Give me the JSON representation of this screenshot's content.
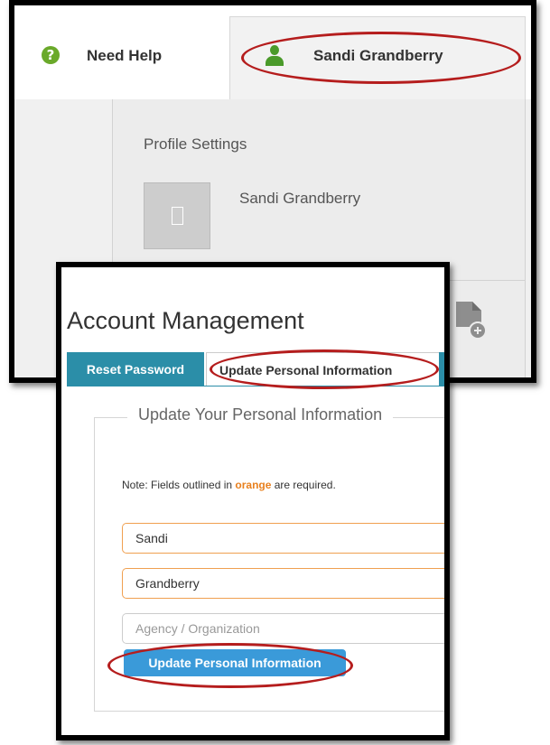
{
  "top_panel": {
    "help_label": "Need Help",
    "help_icon_glyph": "?",
    "user_name": "Sandi Grandberry",
    "dropdown": {
      "heading": "Profile Settings",
      "profile_name": "Sandi Grandberry"
    },
    "colors": {
      "help_green": "#6aa92a",
      "user_green": "#4a9a2a",
      "highlight_red": "#b51d1d"
    },
    "icons": [
      "help-icon",
      "user-icon",
      "avatar-placeholder-icon",
      "new-document-icon"
    ]
  },
  "bottom_panel": {
    "title": "Account Management",
    "tabs": [
      {
        "label": "Reset Password",
        "active": false
      },
      {
        "label": "Update Personal Information",
        "active": true
      }
    ],
    "form": {
      "legend": "Update Your Personal Information",
      "note_prefix": "Note: Fields outlined in ",
      "note_highlight": "orange",
      "note_suffix": " are required.",
      "fields": [
        {
          "value": "Sandi",
          "placeholder": "",
          "required": true
        },
        {
          "value": "Grandberry",
          "placeholder": "",
          "required": true
        },
        {
          "value": "",
          "placeholder": "Agency / Organization",
          "required": false
        }
      ],
      "submit_label": "Update Personal Information"
    },
    "colors": {
      "tab_teal": "#2b8ea8",
      "button_blue": "#3a9ad9",
      "required_orange": "#e8801e"
    }
  }
}
